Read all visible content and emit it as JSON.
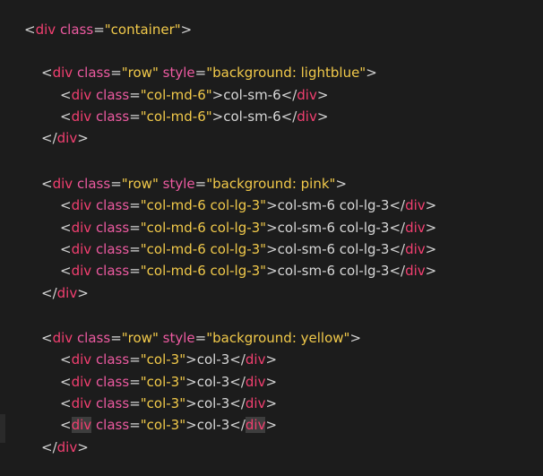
{
  "lines": [
    {
      "indent": 0,
      "tokens": [
        {
          "t": "punct",
          "v": "<"
        },
        {
          "t": "tag",
          "v": "div"
        },
        {
          "t": "punct",
          "v": " "
        },
        {
          "t": "attr",
          "v": "class"
        },
        {
          "t": "punct",
          "v": "="
        },
        {
          "t": "str",
          "v": "\"container\""
        },
        {
          "t": "punct",
          "v": ">"
        }
      ]
    },
    {
      "indent": 1,
      "tokens": [
        {
          "t": "punct",
          "v": "<"
        },
        {
          "t": "tag",
          "v": "div"
        },
        {
          "t": "punct",
          "v": " "
        },
        {
          "t": "attr",
          "v": "class"
        },
        {
          "t": "punct",
          "v": "="
        },
        {
          "t": "str",
          "v": "\"row\""
        },
        {
          "t": "punct",
          "v": " "
        },
        {
          "t": "attr",
          "v": "style"
        },
        {
          "t": "punct",
          "v": "="
        },
        {
          "t": "str",
          "v": "\"background: lightblue\""
        },
        {
          "t": "punct",
          "v": ">"
        }
      ]
    },
    {
      "indent": 2,
      "tokens": [
        {
          "t": "punct",
          "v": "<"
        },
        {
          "t": "tag",
          "v": "div"
        },
        {
          "t": "punct",
          "v": " "
        },
        {
          "t": "attr",
          "v": "class"
        },
        {
          "t": "punct",
          "v": "="
        },
        {
          "t": "str",
          "v": "\"col-md-6\""
        },
        {
          "t": "punct",
          "v": ">"
        },
        {
          "t": "text",
          "v": "col-sm-6"
        },
        {
          "t": "punct",
          "v": "</"
        },
        {
          "t": "tag",
          "v": "div"
        },
        {
          "t": "punct",
          "v": ">"
        }
      ]
    },
    {
      "indent": 2,
      "tokens": [
        {
          "t": "punct",
          "v": "<"
        },
        {
          "t": "tag",
          "v": "div"
        },
        {
          "t": "punct",
          "v": " "
        },
        {
          "t": "attr",
          "v": "class"
        },
        {
          "t": "punct",
          "v": "="
        },
        {
          "t": "str",
          "v": "\"col-md-6\""
        },
        {
          "t": "punct",
          "v": ">"
        },
        {
          "t": "text",
          "v": "col-sm-6"
        },
        {
          "t": "punct",
          "v": "</"
        },
        {
          "t": "tag",
          "v": "div"
        },
        {
          "t": "punct",
          "v": ">"
        }
      ]
    },
    {
      "indent": 1,
      "tokens": [
        {
          "t": "punct",
          "v": "</"
        },
        {
          "t": "tag",
          "v": "div"
        },
        {
          "t": "punct",
          "v": ">"
        }
      ]
    },
    {
      "indent": 1,
      "tokens": [
        {
          "t": "punct",
          "v": "<"
        },
        {
          "t": "tag",
          "v": "div"
        },
        {
          "t": "punct",
          "v": " "
        },
        {
          "t": "attr",
          "v": "class"
        },
        {
          "t": "punct",
          "v": "="
        },
        {
          "t": "str",
          "v": "\"row\""
        },
        {
          "t": "punct",
          "v": " "
        },
        {
          "t": "attr",
          "v": "style"
        },
        {
          "t": "punct",
          "v": "="
        },
        {
          "t": "str",
          "v": "\"background: pink\""
        },
        {
          "t": "punct",
          "v": ">"
        }
      ]
    },
    {
      "indent": 2,
      "tokens": [
        {
          "t": "punct",
          "v": "<"
        },
        {
          "t": "tag",
          "v": "div"
        },
        {
          "t": "punct",
          "v": " "
        },
        {
          "t": "attr",
          "v": "class"
        },
        {
          "t": "punct",
          "v": "="
        },
        {
          "t": "str",
          "v": "\"col-md-6 col-lg-3\""
        },
        {
          "t": "punct",
          "v": ">"
        },
        {
          "t": "text",
          "v": "col-sm-6 col-lg-3"
        },
        {
          "t": "punct",
          "v": "</"
        },
        {
          "t": "tag",
          "v": "div"
        },
        {
          "t": "cursor",
          "v": ">"
        }
      ]
    },
    {
      "indent": 2,
      "tokens": [
        {
          "t": "punct",
          "v": "<"
        },
        {
          "t": "tag",
          "v": "div"
        },
        {
          "t": "punct",
          "v": " "
        },
        {
          "t": "attr",
          "v": "class"
        },
        {
          "t": "punct",
          "v": "="
        },
        {
          "t": "str",
          "v": "\"col-md-6 col-lg-3\""
        },
        {
          "t": "punct",
          "v": ">"
        },
        {
          "t": "text",
          "v": "col-sm-6 col-lg-3"
        },
        {
          "t": "punct",
          "v": "</"
        },
        {
          "t": "tag",
          "v": "div"
        },
        {
          "t": "punct",
          "v": ">"
        }
      ]
    },
    {
      "indent": 2,
      "tokens": [
        {
          "t": "punct",
          "v": "<"
        },
        {
          "t": "tag",
          "v": "div"
        },
        {
          "t": "punct",
          "v": " "
        },
        {
          "t": "attr",
          "v": "class"
        },
        {
          "t": "punct",
          "v": "="
        },
        {
          "t": "str",
          "v": "\"col-md-6 col-lg-3\""
        },
        {
          "t": "punct",
          "v": ">"
        },
        {
          "t": "text",
          "v": "col-sm-6 col-lg-3"
        },
        {
          "t": "punct",
          "v": "</"
        },
        {
          "t": "tag",
          "v": "div"
        },
        {
          "t": "punct",
          "v": ">"
        }
      ]
    },
    {
      "indent": 2,
      "tokens": [
        {
          "t": "punct",
          "v": "<"
        },
        {
          "t": "tag",
          "v": "div"
        },
        {
          "t": "punct",
          "v": " "
        },
        {
          "t": "attr",
          "v": "class"
        },
        {
          "t": "punct",
          "v": "="
        },
        {
          "t": "str",
          "v": "\"col-md-6 col-lg-3\""
        },
        {
          "t": "punct",
          "v": ">"
        },
        {
          "t": "text",
          "v": "col-sm-6 col-lg-3"
        },
        {
          "t": "punct",
          "v": "</"
        },
        {
          "t": "tag",
          "v": "div"
        },
        {
          "t": "punct",
          "v": ">"
        }
      ]
    },
    {
      "indent": 1,
      "tokens": [
        {
          "t": "punct",
          "v": "</"
        },
        {
          "t": "tag",
          "v": "div"
        },
        {
          "t": "punct",
          "v": ">"
        }
      ]
    },
    {
      "indent": 1,
      "tokens": [
        {
          "t": "punct",
          "v": "<"
        },
        {
          "t": "tag",
          "v": "div"
        },
        {
          "t": "punct",
          "v": " "
        },
        {
          "t": "attr",
          "v": "class"
        },
        {
          "t": "punct",
          "v": "="
        },
        {
          "t": "str",
          "v": "\"row\""
        },
        {
          "t": "punct",
          "v": " "
        },
        {
          "t": "attr",
          "v": "style"
        },
        {
          "t": "punct",
          "v": "="
        },
        {
          "t": "str",
          "v": "\"background: yellow\""
        },
        {
          "t": "punct",
          "v": ">"
        }
      ]
    },
    {
      "indent": 2,
      "tokens": [
        {
          "t": "punct",
          "v": "<"
        },
        {
          "t": "tag",
          "v": "div"
        },
        {
          "t": "punct",
          "v": " "
        },
        {
          "t": "attr",
          "v": "class"
        },
        {
          "t": "punct",
          "v": "="
        },
        {
          "t": "str",
          "v": "\"col-3\""
        },
        {
          "t": "punct",
          "v": ">"
        },
        {
          "t": "text",
          "v": "col-3"
        },
        {
          "t": "punct",
          "v": "</"
        },
        {
          "t": "tag",
          "v": "div"
        },
        {
          "t": "punct",
          "v": ">"
        }
      ]
    },
    {
      "indent": 2,
      "tokens": [
        {
          "t": "punct",
          "v": "<"
        },
        {
          "t": "tag",
          "v": "div"
        },
        {
          "t": "punct",
          "v": " "
        },
        {
          "t": "attr",
          "v": "class"
        },
        {
          "t": "punct",
          "v": "="
        },
        {
          "t": "str",
          "v": "\"col-3\""
        },
        {
          "t": "punct",
          "v": ">"
        },
        {
          "t": "text",
          "v": "col-3"
        },
        {
          "t": "punct",
          "v": "</"
        },
        {
          "t": "tag",
          "v": "div"
        },
        {
          "t": "punct",
          "v": ">"
        }
      ]
    },
    {
      "indent": 2,
      "tokens": [
        {
          "t": "punct",
          "v": "<"
        },
        {
          "t": "tag",
          "v": "div"
        },
        {
          "t": "punct",
          "v": " "
        },
        {
          "t": "attr",
          "v": "class"
        },
        {
          "t": "punct",
          "v": "="
        },
        {
          "t": "str",
          "v": "\"col-3\""
        },
        {
          "t": "punct",
          "v": ">"
        },
        {
          "t": "text",
          "v": "col-3"
        },
        {
          "t": "punct",
          "v": "</"
        },
        {
          "t": "tag",
          "v": "div"
        },
        {
          "t": "punct",
          "v": ">"
        }
      ]
    },
    {
      "indent": 2,
      "tokens": [
        {
          "t": "punct",
          "v": "<"
        },
        {
          "t": "hl",
          "v": "div"
        },
        {
          "t": "punct",
          "v": " "
        },
        {
          "t": "attr",
          "v": "class"
        },
        {
          "t": "punct",
          "v": "="
        },
        {
          "t": "str",
          "v": "\"col-3\""
        },
        {
          "t": "punct",
          "v": ">"
        },
        {
          "t": "text",
          "v": "col-3"
        },
        {
          "t": "punct",
          "v": "</"
        },
        {
          "t": "hl",
          "v": "div"
        },
        {
          "t": "punct",
          "v": ">"
        }
      ]
    },
    {
      "indent": 1,
      "tokens": [
        {
          "t": "punct",
          "v": "</"
        },
        {
          "t": "tag",
          "v": "div"
        },
        {
          "t": "punct",
          "v": ">"
        }
      ]
    }
  ]
}
